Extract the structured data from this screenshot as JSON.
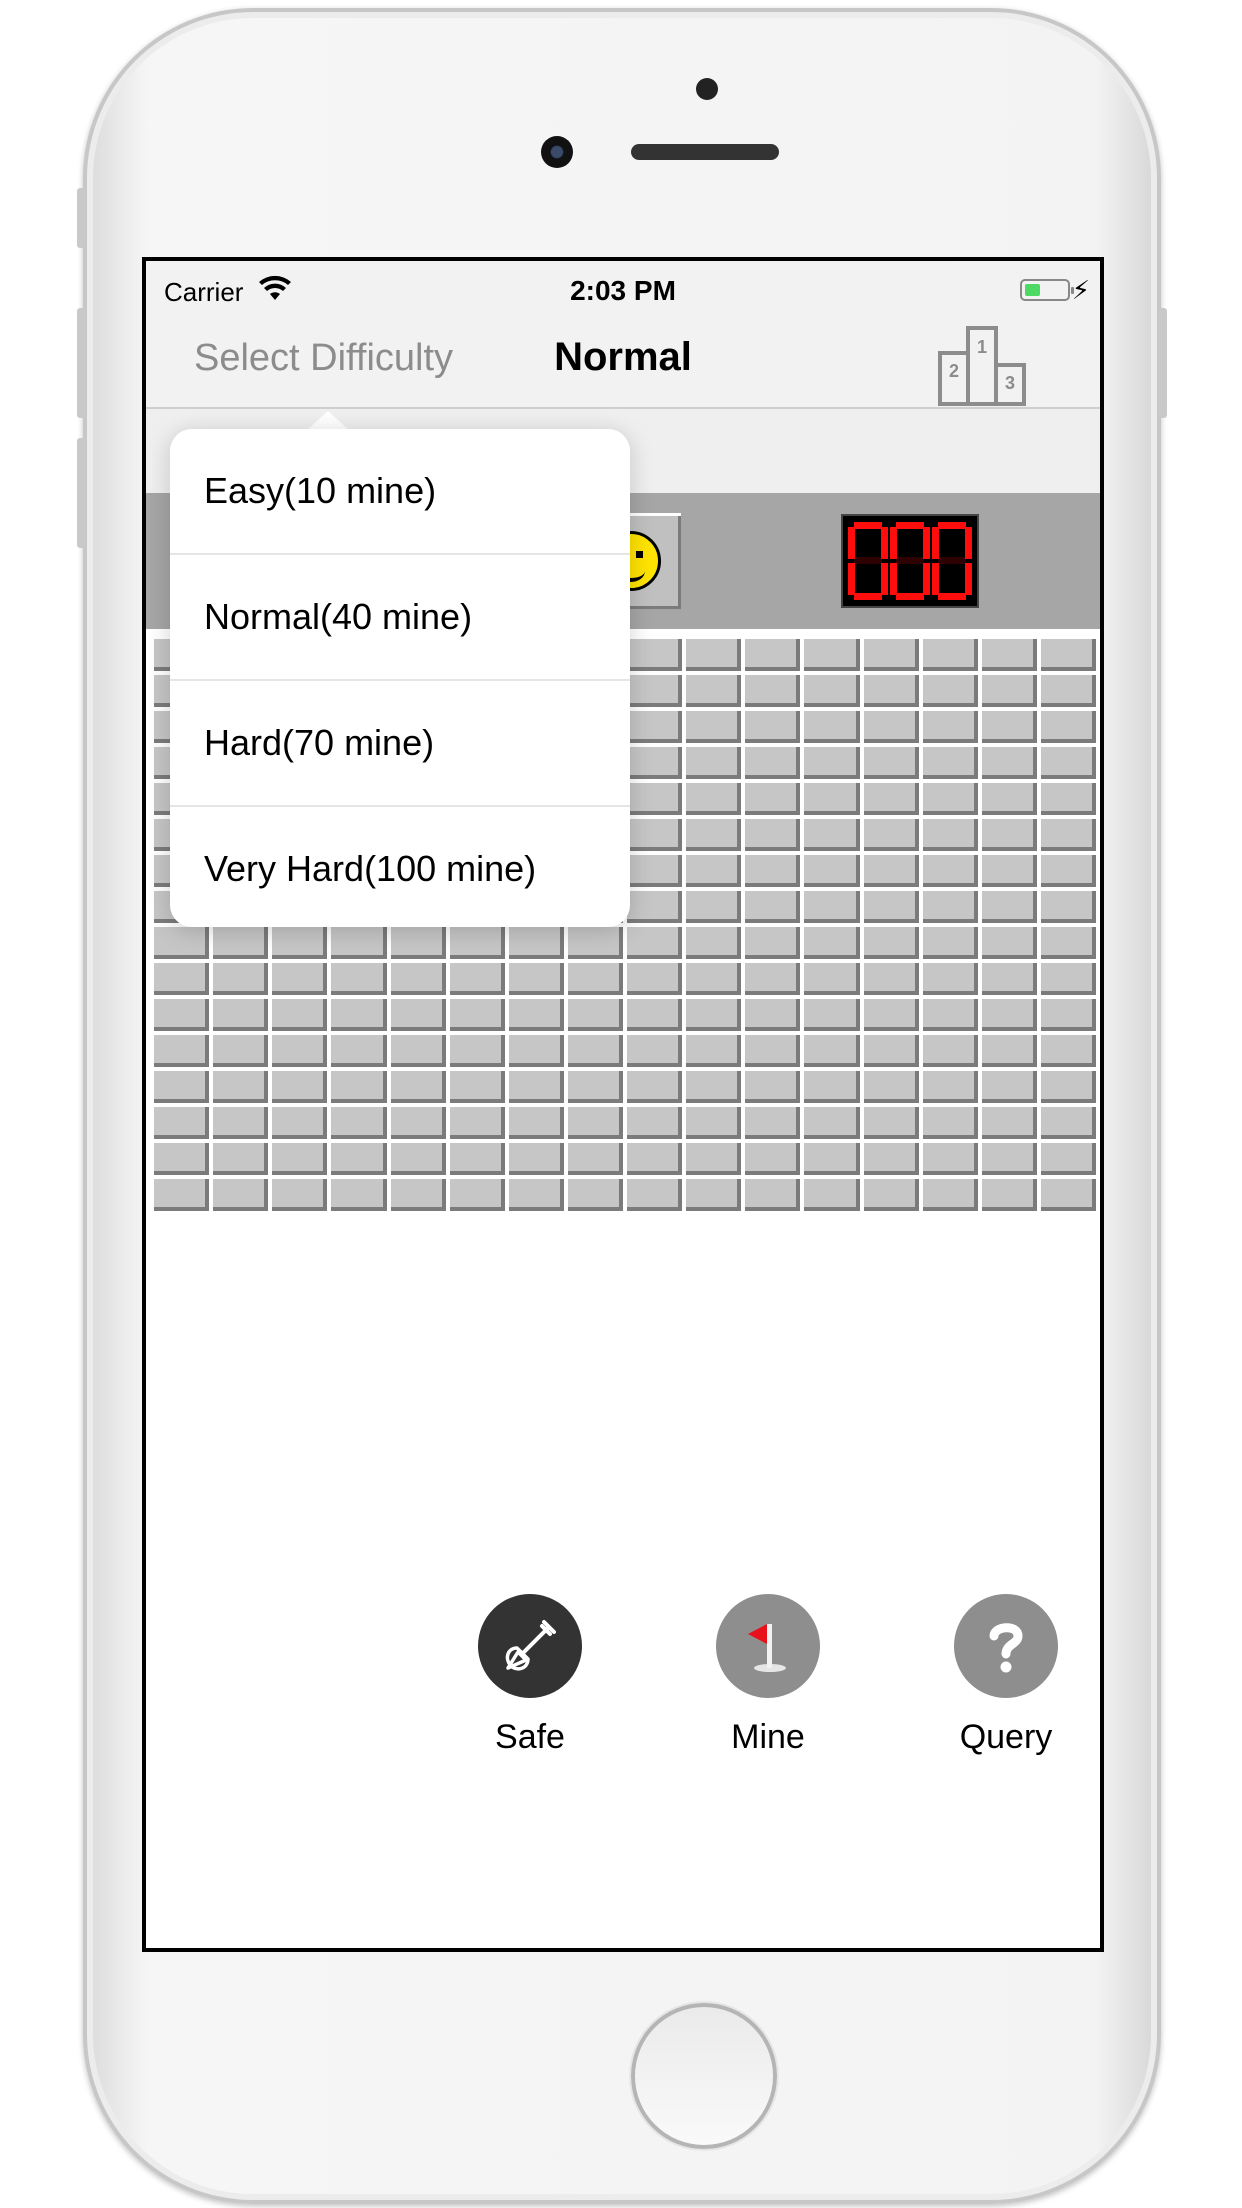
{
  "status_bar": {
    "carrier": "Carrier",
    "time": "2:03 PM",
    "wifi_icon": "wifi-icon",
    "battery_icon": "battery-icon",
    "charging_icon": "charging-bolt-icon",
    "charging_glyph": "⚡"
  },
  "nav": {
    "left_button": "Select Difficulty",
    "title": "Normal",
    "right_icon": "leaderboard-podium-icon",
    "podium_labels": [
      "1",
      "2",
      "3"
    ]
  },
  "game_header": {
    "face_icon": "smiley-face-icon",
    "counter_value": "000",
    "counter_color": "#ff0d0d"
  },
  "board": {
    "rows": 16,
    "columns": 16,
    "state": "unrevealed"
  },
  "toolbar": {
    "tools": [
      {
        "label": "Safe",
        "icon": "shovel-icon",
        "color": "#333333"
      },
      {
        "label": "Mine",
        "icon": "red-flag-icon",
        "color": "#8e8e8e"
      },
      {
        "label": "Query",
        "icon": "question-mark-icon",
        "color": "#8e8e8e"
      }
    ]
  },
  "difficulty_menu": {
    "options": [
      "Easy(10 mine)",
      "Normal(40 mine)",
      "Hard(70 mine)",
      "Very Hard(100 mine)"
    ]
  }
}
